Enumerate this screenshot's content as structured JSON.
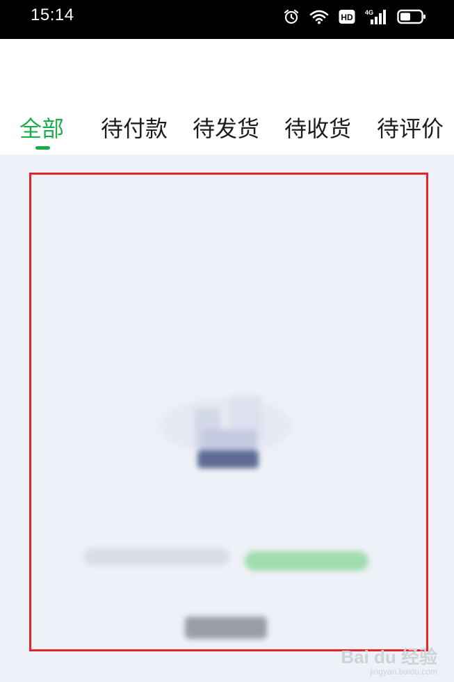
{
  "status_bar": {
    "time": "15:14",
    "icons": [
      "alarm-icon",
      "wifi-icon",
      "hd-icon",
      "signal-4g-icon",
      "battery-icon"
    ],
    "hd_label": "HD",
    "network_label": "4G"
  },
  "tabs": [
    {
      "label": "全部",
      "active": true
    },
    {
      "label": "待付款",
      "active": false
    },
    {
      "label": "待发货",
      "active": false
    },
    {
      "label": "待收货",
      "active": false
    },
    {
      "label": "待评价",
      "active": false
    }
  ],
  "colors": {
    "accent": "#1aad4a",
    "highlight_border": "#e3242b",
    "content_bg": "#eef1f7"
  },
  "watermark": {
    "main": "Bai du 经验",
    "sub": "jingyan.baidu.com"
  }
}
